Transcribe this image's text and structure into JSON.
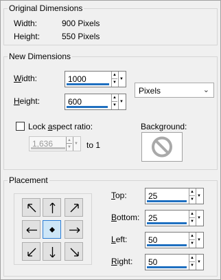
{
  "original": {
    "title": "Original Dimensions",
    "width_label": "Width:",
    "width_value": "900 Pixels",
    "height_label": "Height:",
    "height_value": "550 Pixels"
  },
  "new_dims": {
    "title": "New Dimensions",
    "width_label_first": "W",
    "width_label_rest": "idth:",
    "width_value": "1000",
    "height_label_first": "H",
    "height_label_rest": "eight:",
    "height_value": "600",
    "units": "Pixels",
    "lock_label_pre": "Lock ",
    "lock_label_u": "a",
    "lock_label_post": "spect ratio:",
    "ratio_value": "1,636",
    "ratio_suffix": "to 1",
    "background_label": "Background:"
  },
  "placement": {
    "title": "Placement",
    "top_label_first": "T",
    "top_label_rest": "op:",
    "top_value": "25",
    "bottom_label_first": "B",
    "bottom_label_rest": "ottom:",
    "bottom_value": "25",
    "left_label_first": "L",
    "left_label_rest": "eft:",
    "left_value": "50",
    "right_label_first": "R",
    "right_label_rest": "ight:",
    "right_value": "50",
    "buttons": [
      {
        "name": "arrow-up-left-icon",
        "selected": false
      },
      {
        "name": "arrow-up-icon",
        "selected": false
      },
      {
        "name": "arrow-up-right-icon",
        "selected": false
      },
      {
        "name": "arrow-left-icon",
        "selected": false
      },
      {
        "name": "center-dot-icon",
        "selected": true
      },
      {
        "name": "arrow-right-icon",
        "selected": false
      },
      {
        "name": "arrow-down-left-icon",
        "selected": false
      },
      {
        "name": "arrow-down-icon",
        "selected": false
      },
      {
        "name": "arrow-down-right-icon",
        "selected": false
      }
    ]
  },
  "icons": {
    "spin_up": "up-triangle-icon",
    "spin_down": "down-triangle-icon",
    "dropdown": "dropdown-arrow-icon",
    "no_background": "no-entry-icon"
  },
  "colors": {
    "accent": "#1e6fc0",
    "panel": "#f0f0f0",
    "selected_button": "#cde6f7"
  }
}
